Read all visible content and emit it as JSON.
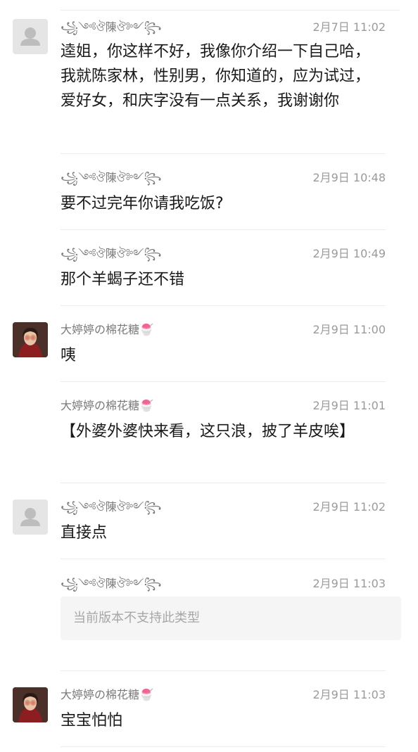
{
  "messages": [
    {
      "sender": "꧁༺ঔ陳ঔ༻꧂",
      "time": "2月7日 11:02",
      "text": "逵姐，你这样不好，我像你介绍一下自己哈，我就陈家林，性别男，你知道的，应为试过，爱好女，和庆字没有一点关系，我谢谢你",
      "avatar": "default-avatar"
    },
    {
      "sender": "꧁༺ঔ陳ঔ༻꧂",
      "time": "2月9日 10:48",
      "text": "要不过完年你请我吃饭?"
    },
    {
      "sender": "꧁༺ঔ陳ঔ༻꧂",
      "time": "2月9日 10:49",
      "text": "那个羊蝎子还不错"
    },
    {
      "sender": "大婷婷の棉花糖🍧",
      "time": "2月9日 11:00",
      "text": "咦",
      "avatar": "photo-avatar"
    },
    {
      "sender": "大婷婷の棉花糖🍧",
      "time": "2月9日 11:01",
      "text": "【外婆外婆快来看，这只浪，披了羊皮唉】"
    },
    {
      "sender": "꧁༺ঔ陳ঔ༻꧂",
      "time": "2月9日 11:02",
      "text": "直接点",
      "avatar": "default-avatar"
    },
    {
      "sender": "꧁༺ঔ陳ঔ༻꧂",
      "time": "2月9日 11:03",
      "unsupported": "当前版本不支持此类型"
    },
    {
      "sender": "大婷婷の棉花糖🍧",
      "time": "2月9日 11:03",
      "text": "宝宝怕怕",
      "avatar": "photo-avatar"
    }
  ],
  "colors": {
    "background": "#ffffff",
    "sender": "#7a7a7a",
    "time": "#9a9a9a",
    "text": "#191919",
    "divider": "#ececec",
    "unsupported_bg": "#f5f5f5",
    "unsupported_text": "#a7a7a7"
  }
}
